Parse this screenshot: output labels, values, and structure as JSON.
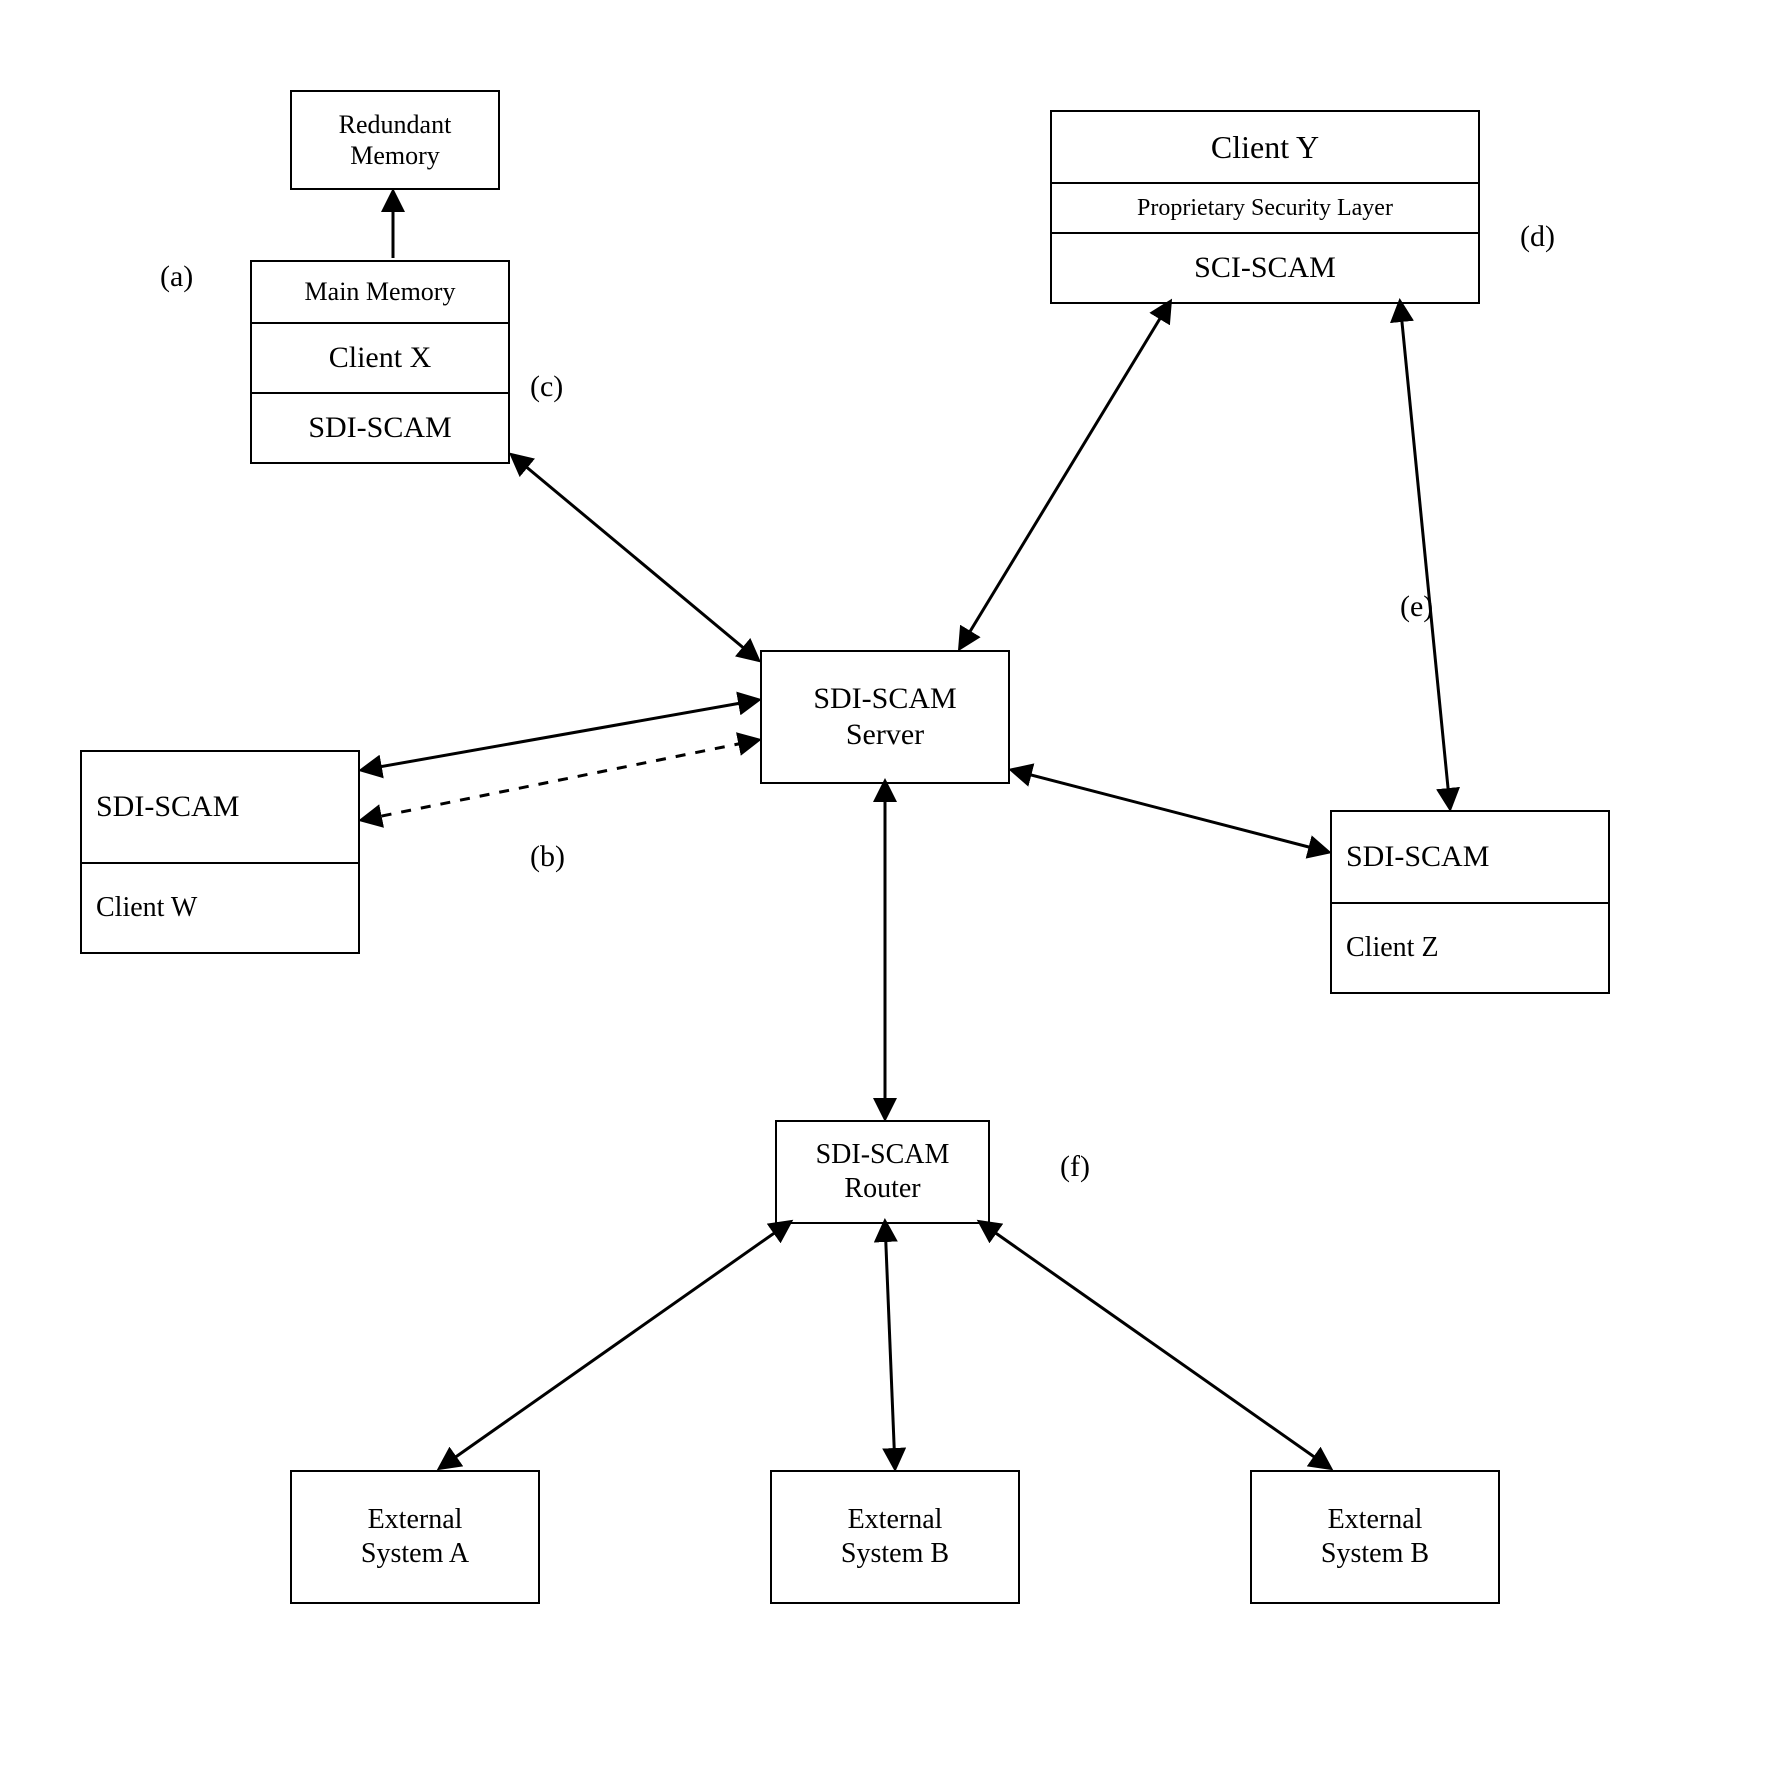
{
  "nodes": {
    "redundant_memory": {
      "lines": [
        "Redundant",
        "Memory"
      ]
    },
    "client_x": {
      "rows": [
        "Main Memory",
        "Client X",
        "SDI-SCAM"
      ]
    },
    "client_y": {
      "rows": [
        "Client Y",
        "Proprietary Security Layer",
        "SCI-SCAM"
      ]
    },
    "server": {
      "lines": [
        "SDI-SCAM",
        "Server"
      ]
    },
    "client_w": {
      "rows": [
        "SDI-SCAM",
        "Client W"
      ]
    },
    "client_z": {
      "rows": [
        "SDI-SCAM",
        "Client Z"
      ]
    },
    "router": {
      "lines": [
        "SDI-SCAM",
        "Router"
      ]
    },
    "ext_a": {
      "lines": [
        "External",
        "System A"
      ]
    },
    "ext_b": {
      "lines": [
        "External",
        "System B"
      ]
    },
    "ext_b2": {
      "lines": [
        "External",
        "System B"
      ]
    }
  },
  "labels": {
    "a": "(a)",
    "b": "(b)",
    "c": "(c)",
    "d": "(d)",
    "e": "(e)",
    "f": "(f)"
  },
  "edges_meta": "All edges are bidirectional (double headed arrows); Client W has an extra dashed redundant link (b). Redundant Memory arrow is one-directional up from Main Memory.",
  "diagram_topology": {
    "server_connects_to": [
      "client_x",
      "client_y",
      "client_w",
      "client_z",
      "router"
    ],
    "client_y_connects_to": [
      "client_z"
    ],
    "client_x_connects_to": [
      "redundant_memory"
    ],
    "router_connects_to": [
      "ext_a",
      "ext_b",
      "ext_b2"
    ]
  }
}
